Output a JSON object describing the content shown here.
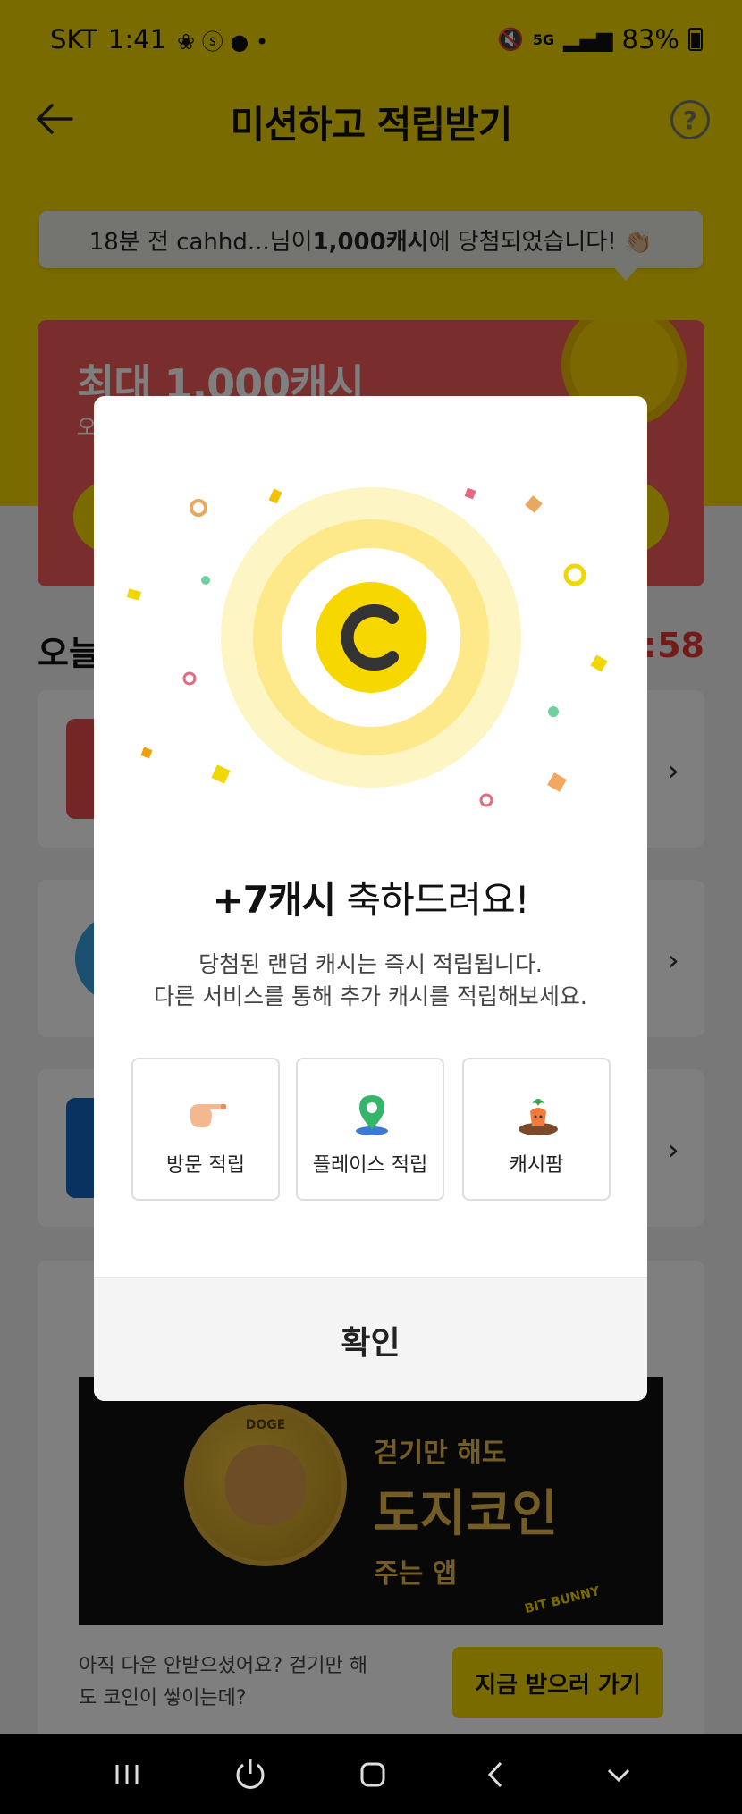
{
  "status_bar": {
    "carrier": "SKT",
    "time": "1:41",
    "network": "5G",
    "battery": "83%"
  },
  "header": {
    "title": "미션하고 적립받기"
  },
  "toast": {
    "prefix": "18분 전 cahhd...님이 ",
    "amount": "1,000캐시",
    "suffix": "에 당첨되었습니다! 👏🏼"
  },
  "promo": {
    "title": "최대 1,000캐시",
    "subtitle": "오"
  },
  "section": {
    "title": "오늘",
    "timer": "9:58"
  },
  "modal": {
    "title_amount": "+7캐시",
    "title_rest": " 축하드려요!",
    "desc_line1": "당첨된 랜덤 캐시는 즉시 적립됩니다.",
    "desc_line2": "다른 서비스를 통해 추가 캐시를 적립해보세요.",
    "options": [
      {
        "label": "방문 적립",
        "icon": "pointing-hand-icon"
      },
      {
        "label": "플레이스 적립",
        "icon": "map-pin-icon"
      },
      {
        "label": "캐시팜",
        "icon": "carrot-farm-icon"
      }
    ],
    "confirm_label": "확인"
  },
  "ad": {
    "banner_line1": "걷기만 해도",
    "banner_line2": "도지코인",
    "banner_line3": "주는 앱",
    "brand": "BIT BUNNY",
    "coin_text": "DOGE",
    "desc": "아직 다운 안받으셨어요? 걷기만 해도 코인이 쌓이는데?",
    "cta": "지금 받으러 가기"
  },
  "colors": {
    "brand_yellow": "#f2d600",
    "promo_red": "#f25a5a",
    "timer_red": "#e53935"
  }
}
